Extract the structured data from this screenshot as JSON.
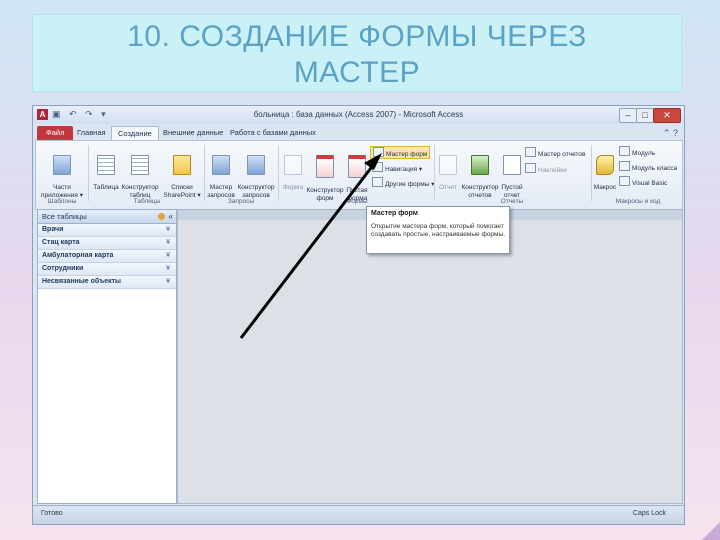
{
  "slide": {
    "title_line1": "10. СОЗДАНИЕ ФОРМЫ ЧЕРЕЗ",
    "title_line2": "МАСТЕР"
  },
  "window": {
    "app_icon": "A",
    "title": "больница : база данных (Access 2007) - Microsoft Access",
    "controls": {
      "minimize": "–",
      "maximize": "□",
      "close": "✕"
    },
    "qat_icons": [
      "save-icon",
      "undo-icon",
      "redo-icon",
      "customize-icon"
    ]
  },
  "tabs": [
    "Файл",
    "Главная",
    "Создание",
    "Внешние данные",
    "Работа с базами данных"
  ],
  "active_tab": "Создание",
  "ribbon": {
    "templates": {
      "parts": "Части\nприложения ▾",
      "group": "Шаблоны"
    },
    "tables": {
      "table": "Таблица",
      "designer": "Конструктор\nтаблиц",
      "sharepoint": "Списки\nSharePoint ▾",
      "group": "Таблицы"
    },
    "queries": {
      "wizard": "Мастер\nзапросов",
      "designer": "Конструктор\nзапросов",
      "group": "Запросы"
    },
    "forms": {
      "form": "Форма",
      "designer": "Конструктор\nформ",
      "blank": "Пустая\nформа",
      "wizard": "Мастер форм",
      "navigation": "Навигация ▾",
      "other": "Другие формы ▾",
      "group": "Формы"
    },
    "reports": {
      "report": "Отчет",
      "designer": "Конструктор\nотчетов",
      "blank": "Пустой\nотчет",
      "wizard": "Мастер отчетов",
      "labels": "Наклейки",
      "group": "Отчеты"
    },
    "macros": {
      "macro": "Макрос",
      "module": "Модуль",
      "class_module": "Модуль класса",
      "vba": "Visual Basic",
      "group": "Макросы и код"
    }
  },
  "nav": {
    "header": "Все таблицы",
    "items": [
      "Врачи",
      "Стац карта",
      "Амбулаторная карта",
      "Сотрудники",
      "Несвязанные объекты"
    ]
  },
  "tooltip": {
    "title": "Мастер форм",
    "body": "Открытие мастера форм, который помогает создавать простые, настраиваемые формы."
  },
  "status": {
    "left": "Готово",
    "right": "Caps Lock"
  },
  "colors": {
    "title_text": "#5ba2c6",
    "title_bg": "#c9f1f6",
    "file_tab": "#c2363d",
    "highlight": "#fde79a"
  }
}
